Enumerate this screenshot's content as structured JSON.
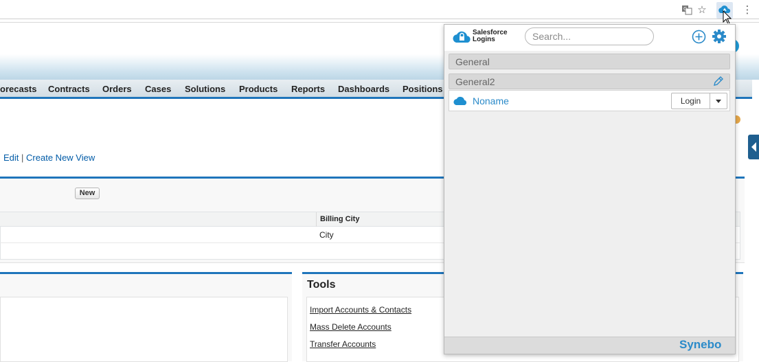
{
  "browser": {
    "icons": [
      "translate-icon",
      "star-icon",
      "salesforce-logins-extension-icon",
      "menu-icon"
    ]
  },
  "salesforce": {
    "tabs": [
      "orecasts",
      "Contracts",
      "Orders",
      "Cases",
      "Solutions",
      "Products",
      "Reports",
      "Dashboards",
      "Positions"
    ],
    "view_links": {
      "edit": "Edit",
      "sep": "|",
      "create": "Create New View"
    },
    "new_button": "New",
    "table": {
      "column_billing_city": "Billing City",
      "row1_billing_city": "City"
    },
    "tools": {
      "title": "Tools",
      "links": [
        "Import Accounts & Contacts",
        "Mass Delete Accounts",
        "Transfer Accounts"
      ]
    }
  },
  "popup": {
    "logo_line1": "Salesforce",
    "logo_line2": "Logins",
    "search_placeholder": "Search...",
    "groups": [
      {
        "name": "General",
        "orgs": []
      },
      {
        "name": "General2",
        "orgs": [
          {
            "name": "Noname"
          }
        ]
      }
    ],
    "login_button": "Login",
    "footer_brand": "Synebo",
    "accent_color": "#2a8ac9"
  }
}
